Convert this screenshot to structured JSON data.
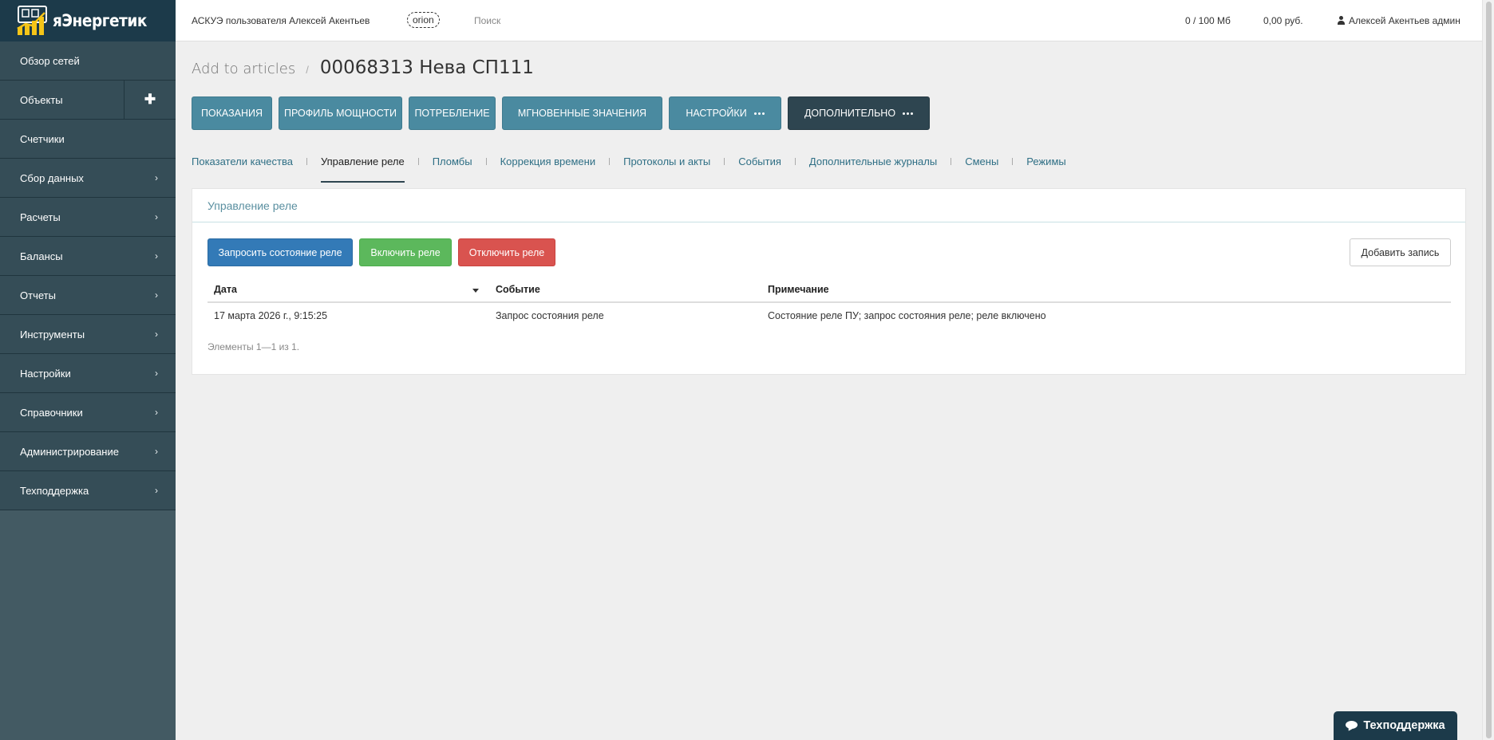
{
  "brand": {
    "name": "яЭнергетик"
  },
  "sidebar": {
    "items": [
      {
        "label": "Обзор сетей",
        "has_children": false
      },
      {
        "label": "Объекты",
        "has_plus": true
      },
      {
        "label": "Счетчики",
        "has_children": false
      },
      {
        "label": "Сбор данных",
        "has_children": true
      },
      {
        "label": "Расчеты",
        "has_children": true
      },
      {
        "label": "Балансы",
        "has_children": true
      },
      {
        "label": "Отчеты",
        "has_children": true
      },
      {
        "label": "Инструменты",
        "has_children": true
      },
      {
        "label": "Настройки",
        "has_children": true
      },
      {
        "label": "Справочники",
        "has_children": true
      },
      {
        "label": "Администрирование",
        "has_children": true
      },
      {
        "label": "Техподдержка",
        "has_children": true
      }
    ]
  },
  "topbar": {
    "title": "АСКУЭ пользователя Алексей Акентьев",
    "server_badge": "orion",
    "search_label": "Поиск",
    "storage": "0 / 100 Мб",
    "balance": "0,00 руб.",
    "user": "Алексей Акентьев админ"
  },
  "breadcrumb": {
    "link": "Add to articles",
    "separator": "/",
    "current": "00068313 Нева СП111"
  },
  "tabs": [
    {
      "label": "ПОКАЗАНИЯ",
      "menu": false,
      "dark": false
    },
    {
      "label": "ПРОФИЛЬ МОЩНОСТИ",
      "menu": false,
      "dark": false
    },
    {
      "label": "ПОТРЕБЛЕНИЕ",
      "menu": false,
      "dark": false
    },
    {
      "label": "МГНОВЕННЫЕ ЗНАЧЕНИЯ",
      "menu": false,
      "dark": false
    },
    {
      "label": "НАСТРОЙКИ",
      "menu": true,
      "dark": false
    },
    {
      "label": "ДОПОЛНИТЕЛЬНО",
      "menu": true,
      "dark": true
    }
  ],
  "subtabs": [
    {
      "label": "Показатели качества",
      "active": false
    },
    {
      "label": "Управление реле",
      "active": true
    },
    {
      "label": "Пломбы",
      "active": false
    },
    {
      "label": "Коррекция времени",
      "active": false
    },
    {
      "label": "Протоколы и акты",
      "active": false
    },
    {
      "label": "События",
      "active": false
    },
    {
      "label": "Дополнительные журналы",
      "active": false
    },
    {
      "label": "Смены",
      "active": false
    },
    {
      "label": "Режимы",
      "active": false
    }
  ],
  "panel": {
    "title": "Управление реле",
    "buttons": {
      "request": "Запросить состояние реле",
      "enable": "Включить реле",
      "disable": "Отключить реле",
      "add": "Добавить запись"
    },
    "table": {
      "columns": [
        "Дата",
        "Событие",
        "Примечание"
      ],
      "sort_column": "Дата",
      "sort_direction": "desc",
      "rows": [
        [
          "17 марта 2026 г., 9:15:25",
          "Запрос состояния реле",
          "Состояние реле ПУ; запрос состояния реле; реле включено"
        ]
      ]
    },
    "pager": "Элементы 1—1 из 1."
  },
  "support_button": "Техподдержка",
  "colors": {
    "sidebar": "#354d57",
    "logo_bar": "#1c3a4a",
    "tab_button": "#4a8aa0",
    "tab_button_dark": "#2e4550",
    "primary": "#337ab7",
    "success": "#5cb85c",
    "danger": "#d9534f",
    "link": "#2f6f85"
  }
}
